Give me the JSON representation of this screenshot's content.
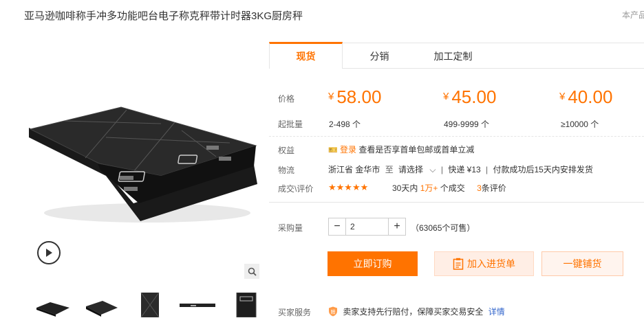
{
  "product": {
    "title": "亚马逊咖啡称手冲多功能吧台电子称克秤带计时器3KG厨房秤",
    "corner_note": "本产品"
  },
  "tabs": [
    {
      "label": "现货",
      "active": true
    },
    {
      "label": "分销",
      "active": false
    },
    {
      "label": "加工定制",
      "active": false
    }
  ],
  "pricing": {
    "price_label": "价格",
    "batch_label": "起批量",
    "currency": "¥",
    "tiers": [
      {
        "price": "58.00",
        "range": "2-498 个"
      },
      {
        "price": "45.00",
        "range": "499-9999 个"
      },
      {
        "price": "40.00",
        "range": "≥10000 个"
      }
    ]
  },
  "benefits": {
    "label": "权益",
    "login_link": "登录",
    "text": "查看是否享首单包邮或首单立减"
  },
  "logistics": {
    "label": "物流",
    "origin": "浙江省 金华市",
    "to": "至",
    "destination_select": "请选择",
    "shipping": "快递 ¥13",
    "dispatch_note": "付款成功后15天内安排发货"
  },
  "reviews": {
    "label": "成交\\评价",
    "stars": "★★★★★",
    "deals_prefix": "30天内",
    "deals_count": "1万+",
    "deals_suffix": "个成交",
    "review_count": "3",
    "review_suffix": "条评价"
  },
  "purchase": {
    "label": "采购量",
    "quantity": "2",
    "available": "（63065个可售）",
    "minus": "−",
    "plus": "+"
  },
  "actions": {
    "buy_now": "立即订购",
    "add_to_cart": "加入进货单",
    "one_click": "一键铺货"
  },
  "service": {
    "label": "买家服务",
    "text": "卖家支持先行赔付，保障买家交易安全",
    "details_link": "详情"
  },
  "colors": {
    "accent": "#ff7300"
  },
  "icons": {
    "play": "play-icon",
    "zoom": "magnifier-icon",
    "cart": "clipboard-icon",
    "coupon": "coupon-icon",
    "chevron": "chevron-down-icon",
    "shield": "shield-icon"
  }
}
